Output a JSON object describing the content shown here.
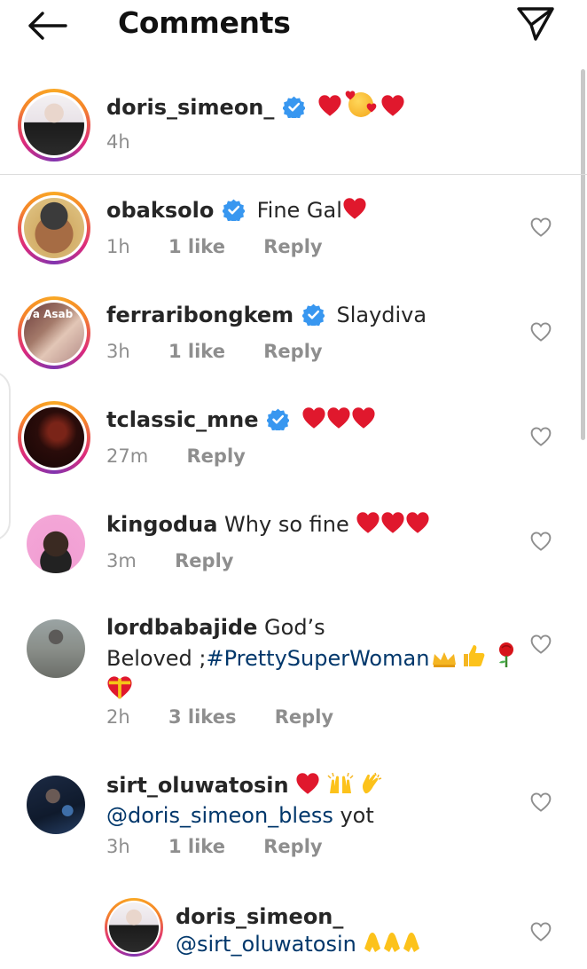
{
  "header": {
    "title": "Comments",
    "back_icon": "arrow-left-icon",
    "send_icon": "paper-plane-icon"
  },
  "comments": [
    {
      "username": "doris_simeon_",
      "verified": true,
      "text": "",
      "emojis": [
        "red-heart",
        "smiling-face-with-hearts",
        "red-heart"
      ],
      "time": "4h",
      "likes": "",
      "reply": ""
    },
    {
      "username": "obaksolo",
      "verified": true,
      "text": "Fine Gal",
      "emojis": [
        "red-heart"
      ],
      "time": "1h",
      "likes": "1 like",
      "reply": "Reply"
    },
    {
      "username": "ferraribongkem",
      "verified": true,
      "text": "Slaydiva",
      "emojis": [],
      "time": "3h",
      "likes": "1 like",
      "reply": "Reply",
      "avatar_text": "ya Asab"
    },
    {
      "username": "tclassic_mne",
      "verified": true,
      "text": "",
      "emojis": [
        "red-heart",
        "red-heart",
        "red-heart"
      ],
      "time": "27m",
      "likes": "",
      "reply": "Reply"
    },
    {
      "username": "kingodua",
      "verified": false,
      "text": "Why so fine",
      "emojis": [
        "red-heart",
        "red-heart",
        "red-heart"
      ],
      "time": "3m",
      "likes": "",
      "reply": "Reply"
    },
    {
      "username": "lordbabajide",
      "verified": false,
      "text_line1": "God’s",
      "text_line2_plain": "Beloved ;",
      "text_line2_tag": "#PrettySuperWoman",
      "emojis": [
        "crown",
        "thumbs-up",
        "rose",
        "heart-with-ribbon"
      ],
      "time": "2h",
      "likes": "3 likes",
      "reply": "Reply"
    },
    {
      "username": "sirt_oluwatosin",
      "verified": false,
      "emojis": [
        "red-heart",
        "raising-hands",
        "clapping-hands"
      ],
      "mention": "@doris_simeon_bless",
      "text_after": " yot",
      "time": "3h",
      "likes": "1 like",
      "reply": "Reply"
    },
    {
      "username": "doris_simeon_",
      "verified": false,
      "mention": "@sirt_oluwatosin",
      "emojis": [
        "folded-hands",
        "folded-hands",
        "folded-hands"
      ]
    }
  ],
  "colors": {
    "text": "#262626",
    "meta": "#8e8e8e",
    "verified": "#3897f0",
    "heart": "#e0182d",
    "mention": "#00376b"
  }
}
